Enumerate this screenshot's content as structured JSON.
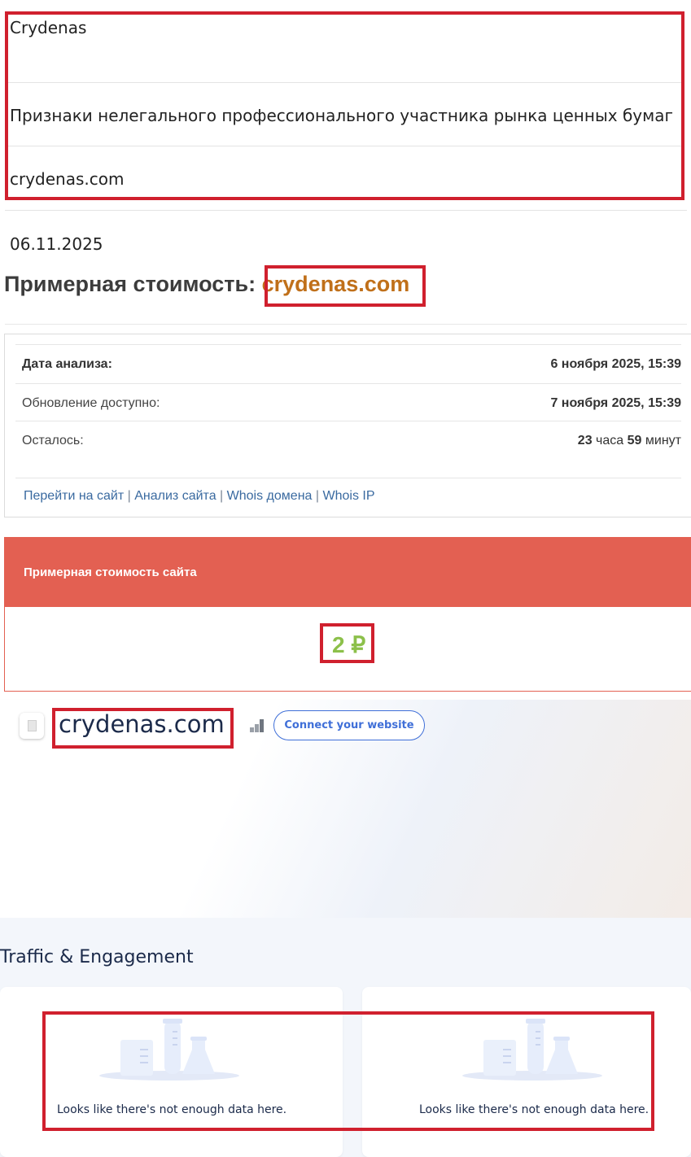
{
  "info": {
    "name": "Crydenas",
    "category": "Признаки нелегального профессионального участника рынка ценных бумаг",
    "domain": "crydenas.com"
  },
  "date": "06.11.2025",
  "price_heading": {
    "label": "Примерная стоимость:",
    "domain": "crydenas.com"
  },
  "analysis": {
    "rows": [
      {
        "label": "Дата анализа:",
        "value": "6 ноября 2025, 15:39"
      },
      {
        "label": "Обновление доступно:",
        "value": "7 ноября 2025, 15:39"
      },
      {
        "label": "Осталось:",
        "hours": "23",
        "hours_unit": "часа",
        "minutes": "59",
        "minutes_unit": "минут"
      }
    ],
    "links": [
      "Перейти на сайт",
      "Анализ сайта",
      "Whois домена",
      "Whois IP"
    ],
    "link_separator": "|"
  },
  "cost": {
    "header": "Примерная стоимость сайта",
    "value": "2 ₽"
  },
  "similarweb": {
    "favicon_icon": "page-icon",
    "domain": "crydenas.com",
    "rank_icon": "bar-chart-icon",
    "connect_button": "Connect your website"
  },
  "traffic": {
    "title": "Traffic & Engagement",
    "cards": [
      {
        "message": "Looks like there's not enough data here.",
        "icon": "lab-illustration-icon"
      },
      {
        "message": "Looks like there's not enough data here.",
        "icon": "lab-illustration-icon"
      }
    ]
  },
  "colors": {
    "highlight_box": "#d0202e",
    "domain_accent": "#c0701a",
    "cost_header": "#e36052",
    "cost_value": "#8cc04a",
    "link": "#3a6aa0",
    "button_blue": "#3f6fd8"
  }
}
